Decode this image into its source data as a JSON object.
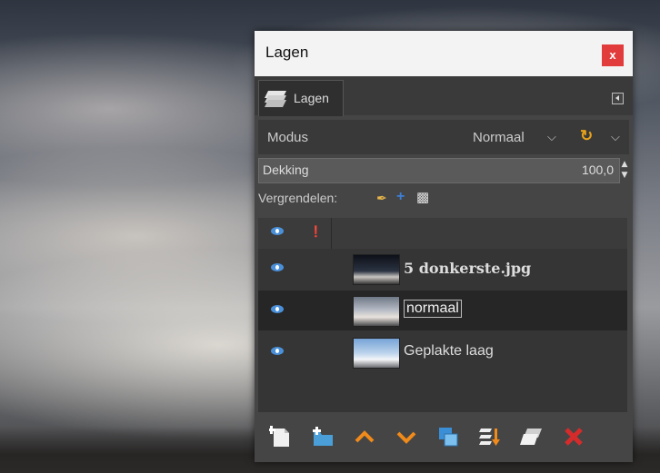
{
  "window": {
    "title": "Lagen",
    "close_label": "x"
  },
  "tab": {
    "label": "Lagen"
  },
  "mode": {
    "label": "Modus",
    "value": "Normaal"
  },
  "opacity": {
    "label": "Dekking",
    "value": "100,0"
  },
  "lock": {
    "label": "Vergrendelen:"
  },
  "layers": [
    {
      "name": "5 donkerste.jpg",
      "visible": true,
      "selected": false
    },
    {
      "name": "normaal",
      "visible": true,
      "selected": true
    },
    {
      "name": "Geplakte laag",
      "visible": true,
      "selected": false
    }
  ],
  "toolbar": [
    "new-layer-icon",
    "new-layer-group-icon",
    "raise-layer-icon",
    "lower-layer-icon",
    "duplicate-layer-icon",
    "merge-down-icon",
    "anchor-layer-icon",
    "delete-layer-icon"
  ],
  "colors": {
    "accent_orange": "#e8a21a",
    "close_red": "#e23b3b",
    "delete_red": "#d62b2b",
    "eye_blue": "#4a90d9"
  }
}
